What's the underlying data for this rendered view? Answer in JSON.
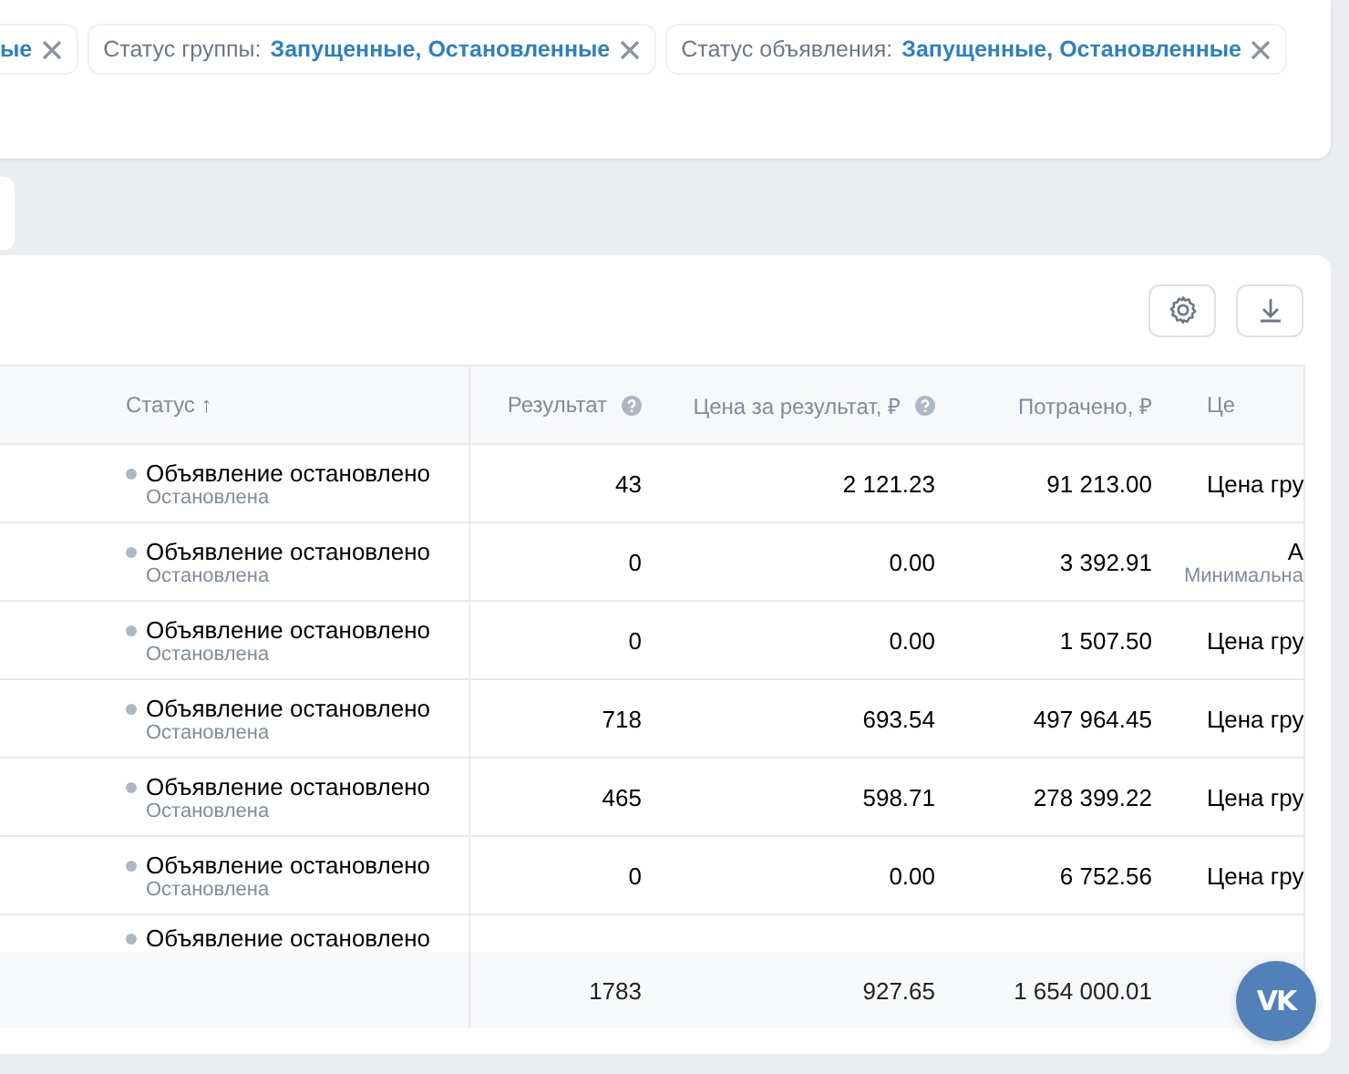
{
  "filters": [
    {
      "value": "ые"
    },
    {
      "label": "Статус группы:",
      "value": "Запущенные, Остановленные"
    },
    {
      "label": "Статус объявления:",
      "value": "Запущенные, Остановленные"
    }
  ],
  "table": {
    "columns": [
      {
        "title": "Статус",
        "sort_arrow": "↑",
        "help": false
      },
      {
        "title": "Результат",
        "help": true
      },
      {
        "title": "Цена за результат, ₽",
        "help": true
      },
      {
        "title": "Потрачено, ₽",
        "help": false
      },
      {
        "title": "Це",
        "help": false
      }
    ],
    "rows": [
      {
        "status": "Объявление остановлено",
        "sub_status": "Остановлена",
        "result": "43",
        "price": "2 121.23",
        "spent": "91 213.00",
        "column_5": {
          "text": "Цена гру"
        }
      },
      {
        "status": "Объявление остановлено",
        "sub_status": "Остановлена",
        "result": "0",
        "price": "0.00",
        "spent": "3 392.91",
        "column_5": {
          "text": "А",
          "sub": "Минимальна"
        }
      },
      {
        "status": "Объявление остановлено",
        "sub_status": "Остановлена",
        "result": "0",
        "price": "0.00",
        "spent": "1 507.50",
        "column_5": {
          "text": "Цена гру"
        }
      },
      {
        "status": "Объявление остановлено",
        "sub_status": "Остановлена",
        "result": "718",
        "price": "693.54",
        "spent": "497 964.45",
        "column_5": {
          "text": "Цена гру"
        }
      },
      {
        "status": "Объявление остановлено",
        "sub_status": "Остановлена",
        "result": "465",
        "price": "598.71",
        "spent": "278 399.22",
        "column_5": {
          "text": "Цена гру"
        }
      },
      {
        "status": "Объявление остановлено",
        "sub_status": "Остановлена",
        "result": "0",
        "price": "0.00",
        "spent": "6 752.56",
        "column_5": {
          "text": "Цена гру"
        }
      },
      {
        "status": "Объявление остановлено"
      }
    ],
    "totals": {
      "result": "1783",
      "price": "927.65",
      "spent": "1 654 000.01"
    }
  },
  "chat_button": {
    "label": "VK"
  }
}
